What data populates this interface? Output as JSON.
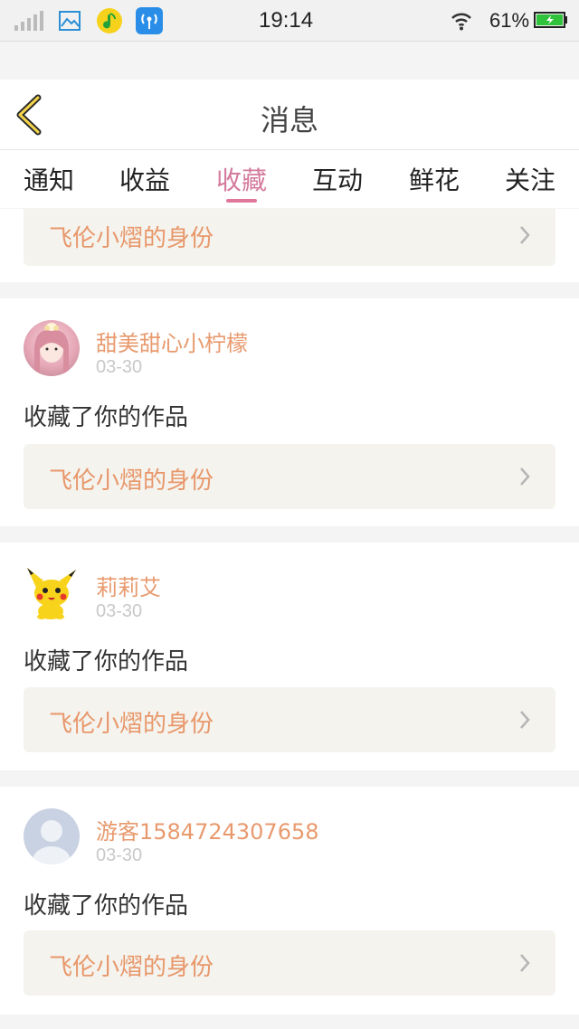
{
  "status_bar": {
    "time": "19:14",
    "battery": "61%",
    "icons": [
      "signal-icon",
      "gallery-icon",
      "qq-music-icon",
      "wifi-share-icon",
      "wifi-icon",
      "battery-icon"
    ]
  },
  "header": {
    "title": "消息",
    "back_icon": "chevron-left-icon"
  },
  "tabs": [
    {
      "label": "通知"
    },
    {
      "label": "收益"
    },
    {
      "label": "收藏",
      "active": true
    },
    {
      "label": "互动"
    },
    {
      "label": "鲜花"
    },
    {
      "label": "关注"
    }
  ],
  "top_partial": {
    "work_title": "飞伦小熠的身份"
  },
  "items": [
    {
      "username": "甜美甜心小柠檬",
      "date": "03-30",
      "action": "收藏了你的作品",
      "work_title": "飞伦小熠的身份"
    },
    {
      "username": "莉莉艾",
      "date": "03-30",
      "action": "收藏了你的作品",
      "work_title": "飞伦小熠的身份"
    },
    {
      "username": "游客1584724307658",
      "date": "03-30",
      "action": "收藏了你的作品",
      "work_title": "飞伦小熠的身份"
    }
  ],
  "colors": {
    "accent_pink": "#e0769a",
    "username_orange": "#e89a6e",
    "link_bg": "#f4f3ee"
  }
}
